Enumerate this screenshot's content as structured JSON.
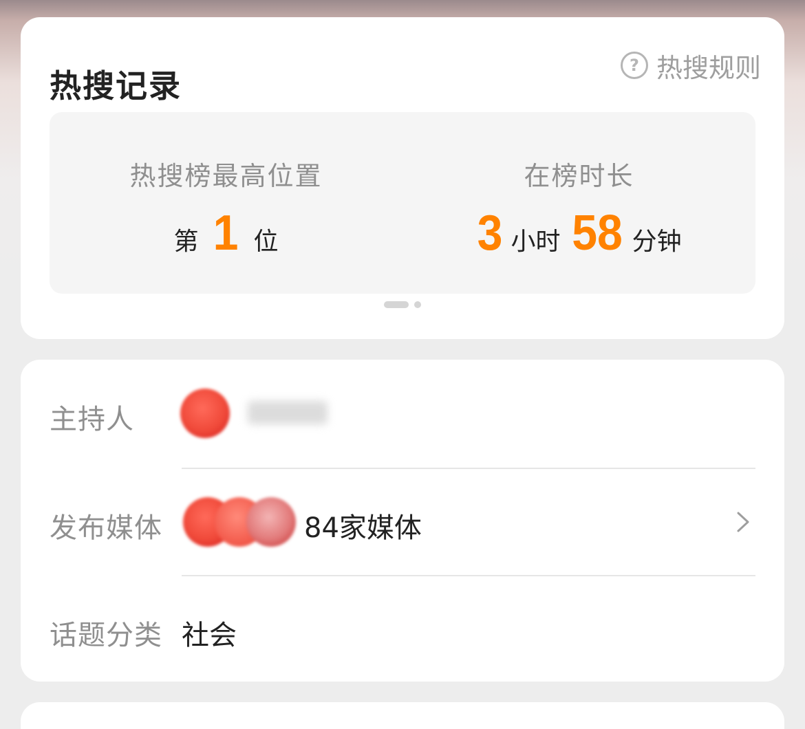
{
  "hot_record": {
    "title": "热搜记录",
    "rules_label": "热搜规则",
    "rules_icon": "question-circle-icon",
    "highest_position": {
      "label": "热搜榜最高位置",
      "prefix": "第",
      "value": "1",
      "suffix": "位"
    },
    "duration": {
      "label": "在榜时长",
      "hours": "3",
      "hours_unit": "小时",
      "minutes": "58",
      "minutes_unit": "分钟"
    },
    "pager": {
      "pages": 2,
      "active": 1
    }
  },
  "info": {
    "host": {
      "label": "主持人"
    },
    "media": {
      "label": "发布媒体",
      "count_text": "84家媒体",
      "chevron_icon": "chevron-right-icon"
    },
    "category": {
      "label": "话题分类",
      "value": "社会"
    }
  },
  "colors": {
    "accent": "#ff8200",
    "label_gray": "#8f8f8f",
    "text_dark": "#222222",
    "card_bg": "#ffffff",
    "page_bg": "#ededed"
  }
}
